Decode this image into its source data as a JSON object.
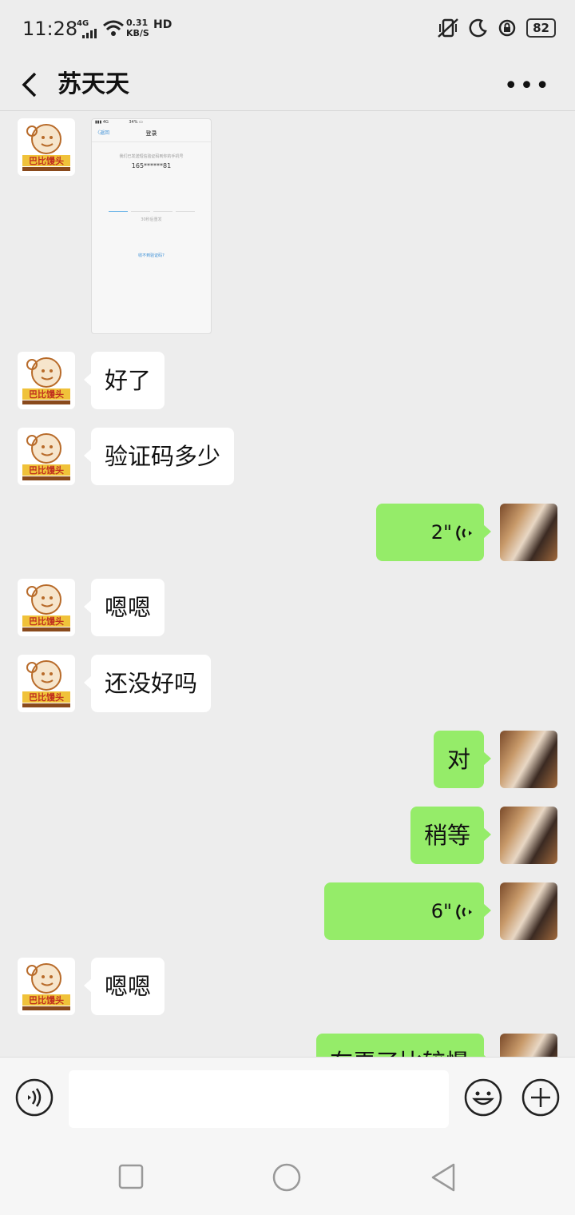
{
  "status_bar": {
    "time": "11:28",
    "network": "4G",
    "speed_value": "0.31",
    "speed_unit": "KB/S",
    "hd": "HD",
    "battery": "82"
  },
  "header": {
    "title": "苏天天"
  },
  "contact_avatar_text": "巴比馒头",
  "screenshot_card": {
    "header": "登录",
    "back_label": "〈返回",
    "subtitle": "我们已发送短信验证码到你的手机号",
    "phone": "165******81",
    "resend": "30秒后重发",
    "link": "收不到验证码?"
  },
  "messages": [
    {
      "side": "left",
      "type": "image"
    },
    {
      "side": "left",
      "type": "text",
      "text": "好了"
    },
    {
      "side": "left",
      "type": "text",
      "text": "验证码多少"
    },
    {
      "side": "right",
      "type": "voice",
      "text": "2\""
    },
    {
      "side": "left",
      "type": "text",
      "text": "嗯嗯"
    },
    {
      "side": "left",
      "type": "text",
      "text": "还没好吗"
    },
    {
      "side": "right",
      "type": "text",
      "text": "对"
    },
    {
      "side": "right",
      "type": "text",
      "text": "稍等"
    },
    {
      "side": "right",
      "type": "voice",
      "text": "6\""
    },
    {
      "side": "left",
      "type": "text",
      "text": "嗯嗯"
    },
    {
      "side": "right",
      "type": "text",
      "text": "在弄了比较慢"
    }
  ],
  "colors": {
    "self_bubble": "#95ec69",
    "other_bubble": "#ffffff",
    "background": "#ededed"
  }
}
